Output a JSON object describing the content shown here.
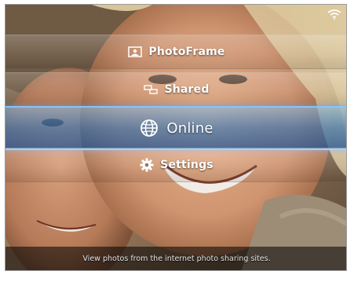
{
  "menu": {
    "items": [
      {
        "label": "PhotoFrame",
        "icon": "photoframe-icon",
        "selected": false
      },
      {
        "label": "Shared",
        "icon": "shared-icon",
        "selected": false
      },
      {
        "label": "Online",
        "icon": "globe-icon",
        "selected": true
      },
      {
        "label": "Settings",
        "icon": "gear-icon",
        "selected": false
      }
    ]
  },
  "status": {
    "description": "View photos from the internet photo sharing sites."
  },
  "indicators": {
    "wifi_icon": "wifi-icon"
  },
  "colors": {
    "selection_highlight": "#2f7fc8",
    "text": "#ffffff"
  }
}
